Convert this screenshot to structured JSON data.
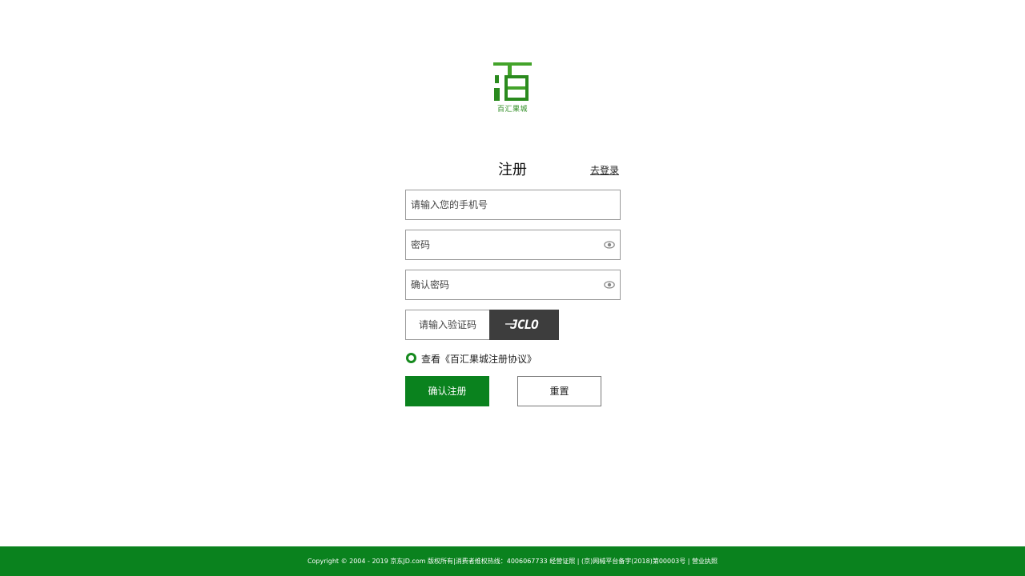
{
  "logo": {
    "caption": "百汇果城",
    "accent": "#43a32a"
  },
  "form": {
    "title": "注册",
    "login_link": "去登录",
    "phone_placeholder": "请输入您的手机号",
    "password_placeholder": "密码",
    "confirm_placeholder": "确认密码",
    "captcha_placeholder": "请输入验证码",
    "captcha_code": "JCLO",
    "agreement": "查看《百汇果城注册协议》",
    "submit_label": "确认注册",
    "reset_label": "重置"
  },
  "footer": {
    "text": "Copyright © 2004 - 2019 京东JD.com 版权所有|消费者维权热线：4006067733 经营证照 | (京)网械平台备字(2018)第00003号 | 营业执照"
  },
  "colors": {
    "primary": "#0a821e",
    "captcha_bg": "#3d3d3d"
  },
  "icons": {
    "password_toggle": "eye-icon",
    "confirm_toggle": "eye-icon"
  }
}
